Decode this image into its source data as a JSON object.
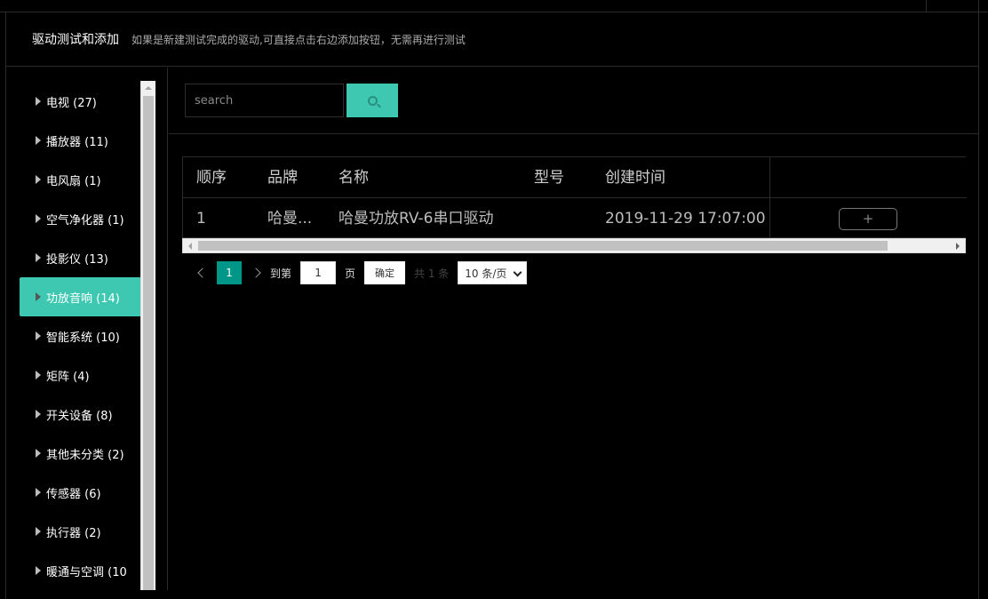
{
  "header": {
    "title": "驱动测试和添加",
    "hint": "如果是新建测试完成的驱动,可直接点击右边添加按钮，无需再进行测试"
  },
  "sidebar": {
    "items": [
      {
        "label": "电视 (27)"
      },
      {
        "label": "播放器 (11)"
      },
      {
        "label": "电风扇 (1)"
      },
      {
        "label": "空气净化器 (1)"
      },
      {
        "label": "投影仪 (13)"
      },
      {
        "label": "功放音响 (14)"
      },
      {
        "label": "智能系统 (10)"
      },
      {
        "label": "矩阵 (4)"
      },
      {
        "label": "开关设备 (8)"
      },
      {
        "label": "其他未分类 (2)"
      },
      {
        "label": "传感器 (6)"
      },
      {
        "label": "执行器 (2)"
      },
      {
        "label": "暖通与空调 (10"
      }
    ],
    "active_index": 5
  },
  "search": {
    "placeholder": "search",
    "button_icon": "search-icon"
  },
  "table": {
    "columns": [
      "顺序",
      "品牌",
      "名称",
      "型号",
      "创建时间"
    ],
    "rows": [
      {
        "order": "1",
        "brand": "哈曼...",
        "name": "哈曼功放RV-6串口驱动",
        "model": "",
        "created": "2019-11-29 17:07:00",
        "action": "+"
      }
    ]
  },
  "pager": {
    "current_page": "1",
    "goto_label": "到第",
    "goto_value": "1",
    "page_unit": "页",
    "confirm_label": "确定",
    "total_label": "共 1 条",
    "page_size": "10 条/页"
  },
  "colors": {
    "accent": "#3ec8b2",
    "pager_active": "#009688",
    "background": "#000000"
  }
}
